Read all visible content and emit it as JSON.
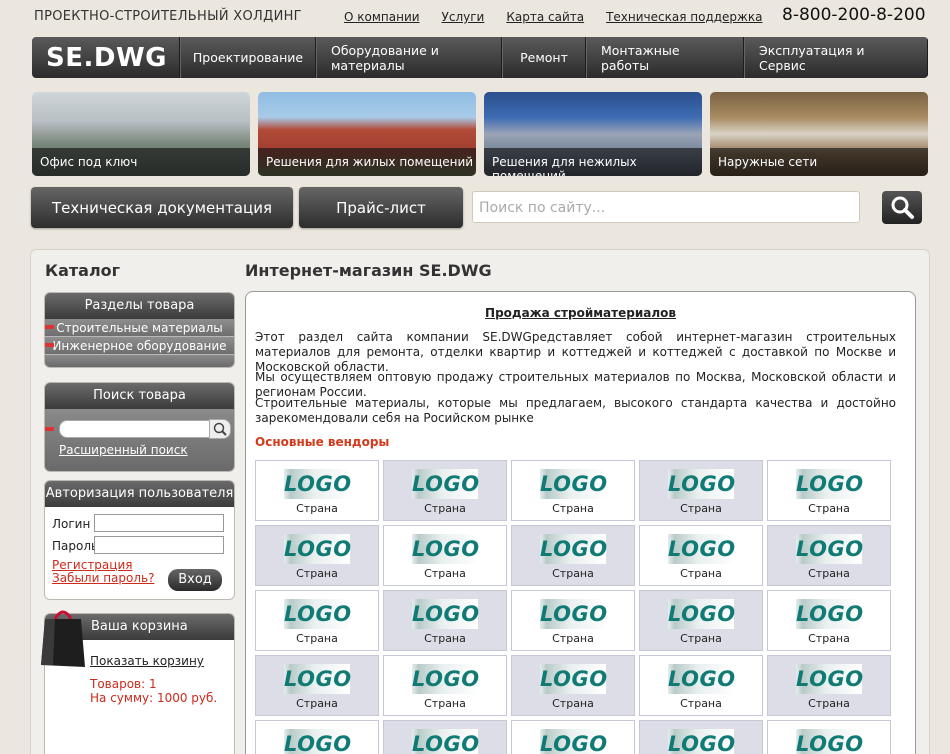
{
  "header": {
    "company": "ПРОЕКТНО-СТРОИТЕЛЬНЫЙ ХОЛДИНГ",
    "links": [
      "О компании",
      "Услуги",
      "Карта сайта",
      "Техническая поддержка"
    ],
    "phone": "8-800-200-8-200"
  },
  "nav": {
    "logo": "SE.DWG",
    "items": [
      "Проектирование",
      "Оборудование и материалы",
      "Ремонт",
      "Монтажные работы",
      "Эксплуатация и Сервис"
    ]
  },
  "tiles": [
    "Офис под ключ",
    "Решения для жилых помещений",
    "Решения для нежилых помещений",
    "Наружные сети"
  ],
  "buttons": {
    "tech_docs": "Техническая документация",
    "price": "Прайс-лист"
  },
  "search": {
    "placeholder": "Поиск по сайту..."
  },
  "sidebar": {
    "catalog_title": "Каталог",
    "sections": {
      "title": "Разделы товара",
      "items": [
        "Строительные материалы",
        "Инженерное оборудование"
      ]
    },
    "product_search": {
      "title": "Поиск товара",
      "advanced": "Расширенный поиск"
    },
    "auth": {
      "title": "Авторизация пользователя",
      "login": "Логин",
      "password": "Пароль",
      "register": "Регистрация",
      "forgot": "Забыли пароль?",
      "submit": "Вход"
    },
    "cart": {
      "title": "Ваша корзина",
      "show": "Показать корзину",
      "items": "Товаров: 1",
      "sum": "На сумму: 1000 руб."
    }
  },
  "main": {
    "title": "Интернет-магазин SE.DWG",
    "heading": "Продажа стройматериалов",
    "p1": "Этот раздел сайта компании SE.DWGредставляет собой интернет-магазин строительных материалов для ремонта, отделки квартир и коттеджей и коттеджей с доставкой по Москве и Московской области.",
    "p2": "Мы осуществляем оптовую продажу строительных материалов по Москва, Московской области и регионам России.",
    "p3": "Строительные материалы, которые мы предлагаем, высокого стандарта качества и достойно зарекомендовали себя на Росийском рынке",
    "vendors_title": "Основные вендоры",
    "logo_text": "LOGO",
    "country": "Страна"
  },
  "colors": {
    "accent": "#d23a1c",
    "nav_dark": "#2b2b2b",
    "logo_teal": "#0f7b74"
  }
}
